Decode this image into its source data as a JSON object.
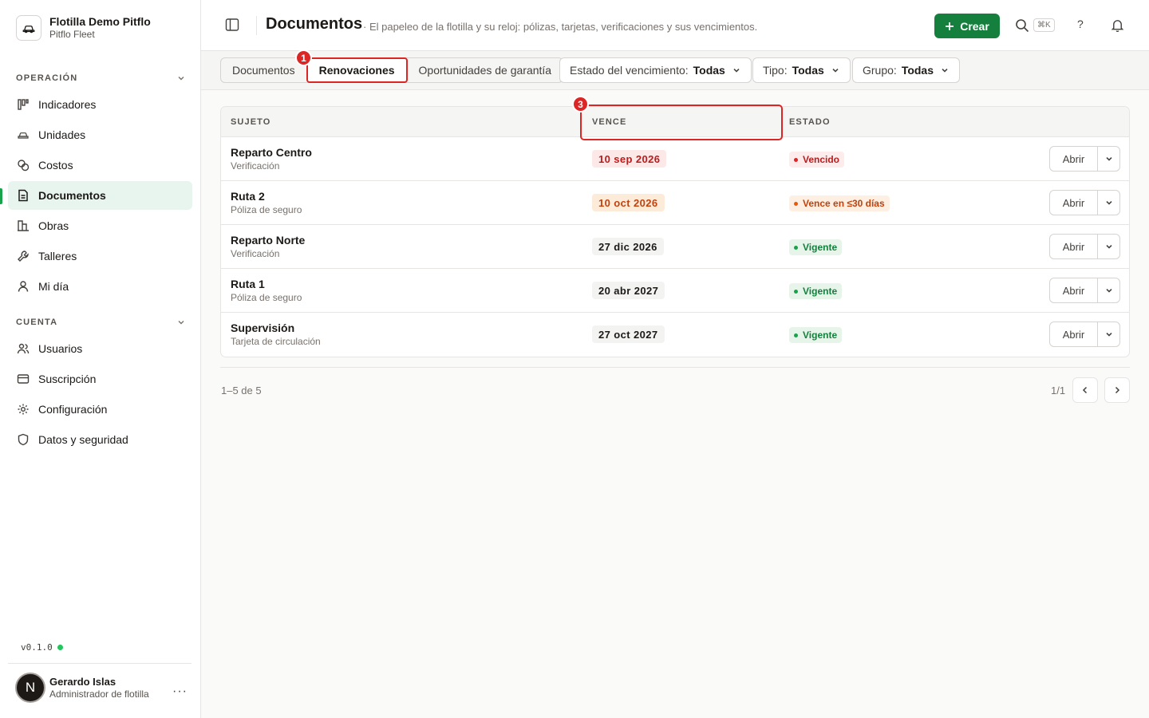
{
  "org": {
    "name": "Flotilla Demo Pitflo",
    "subtitle": "Pitflo Fleet"
  },
  "sidebar": {
    "operacion_label": "OPERACIÓN",
    "operacion_items": [
      {
        "label": "Indicadores",
        "icon": "chart-icon"
      },
      {
        "label": "Unidades",
        "icon": "car-icon"
      },
      {
        "label": "Costos",
        "icon": "coins-icon"
      },
      {
        "label": "Documentos",
        "icon": "document-icon",
        "active": true
      },
      {
        "label": "Obras",
        "icon": "building-icon"
      },
      {
        "label": "Talleres",
        "icon": "wrench-icon"
      },
      {
        "label": "Mi día",
        "icon": "user-icon"
      }
    ],
    "cuenta_label": "CUENTA",
    "cuenta_items": [
      {
        "label": "Usuarios",
        "icon": "users-icon"
      },
      {
        "label": "Suscripción",
        "icon": "card-icon"
      },
      {
        "label": "Configuración",
        "icon": "gear-icon"
      },
      {
        "label": "Datos y seguridad",
        "icon": "shield-icon"
      }
    ],
    "version": "v0.1.0"
  },
  "user": {
    "initial": "N",
    "name": "Gerardo Islas",
    "role": "Administrador de flotilla",
    "more": "···"
  },
  "header": {
    "title": "Documentos",
    "description": "· El papeleo de la flotilla y su reloj: pólizas, tarjetas, verificaciones y sus vencimientos.",
    "create_label": "Crear",
    "shortcut": "⌘K",
    "help": "?"
  },
  "tabs": [
    {
      "label": "Documentos"
    },
    {
      "label": "Renovaciones",
      "selected": true
    },
    {
      "label": "Oportunidades de garantía"
    }
  ],
  "filters": [
    {
      "label": "Estado del vencimiento:",
      "value": "Todas"
    },
    {
      "label": "Tipo:",
      "value": "Todas"
    },
    {
      "label": "Grupo:",
      "value": "Todas"
    }
  ],
  "markers": {
    "tab": "1",
    "column": "3"
  },
  "table": {
    "columns": [
      "SUJETO",
      "VENCE",
      "ESTADO"
    ],
    "rows": [
      {
        "name": "Reparto Centro",
        "type": "Verificación",
        "date": "10 sep 2026",
        "status": "Vencido",
        "tone": "red"
      },
      {
        "name": "Ruta 2",
        "type": "Póliza de seguro",
        "date": "10 oct 2026",
        "status": "Vence en ≤30 días",
        "tone": "orange"
      },
      {
        "name": "Reparto Norte",
        "type": "Verificación",
        "date": "27 dic 2026",
        "status": "Vigente",
        "tone": "green"
      },
      {
        "name": "Ruta 1",
        "type": "Póliza de seguro",
        "date": "20 abr 2027",
        "status": "Vigente",
        "tone": "green"
      },
      {
        "name": "Supervisión",
        "type": "Tarjeta de circulación",
        "date": "27 oct 2027",
        "status": "Vigente",
        "tone": "green"
      }
    ],
    "open_label": "Abrir"
  },
  "pagination": {
    "count": "1–5 de 5",
    "pages": "1/1"
  },
  "colors": {
    "accent": "#15803d",
    "highlight": "#dc2626",
    "active_bg": "#e8f5ee"
  }
}
